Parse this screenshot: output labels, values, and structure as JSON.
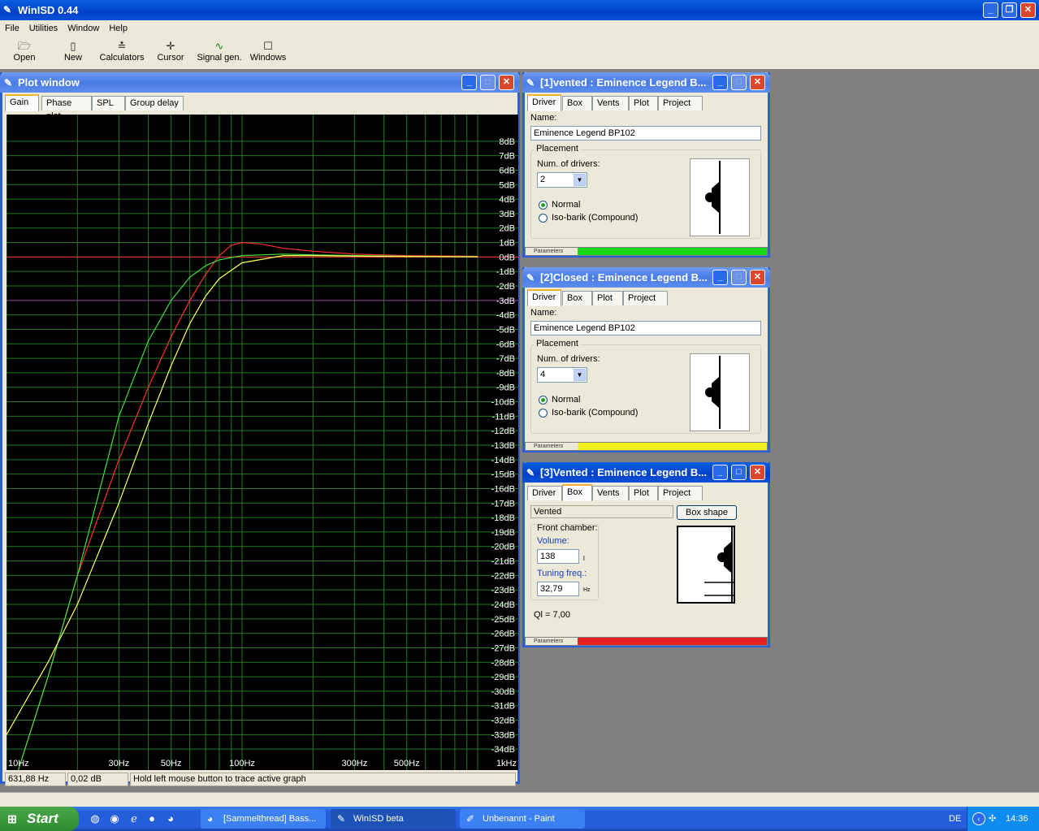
{
  "app": {
    "title": "WinISD 0.44"
  },
  "menu": [
    "File",
    "Utilities",
    "Window",
    "Help"
  ],
  "toolbar": [
    {
      "label": "Open",
      "icon": "folder-open-icon"
    },
    {
      "label": "New",
      "icon": "new-document-icon"
    },
    {
      "label": "Calculators",
      "icon": "calculator-icon"
    },
    {
      "label": "Cursor",
      "icon": "cursor-icon"
    },
    {
      "label": "Signal gen.",
      "icon": "signal-generator-icon"
    },
    {
      "label": "Windows",
      "icon": "windows-icon"
    }
  ],
  "plot_window": {
    "title": "Plot window",
    "tabs": [
      "Gain",
      "Phase plot",
      "SPL",
      "Group delay"
    ],
    "status": {
      "freq": "631,88 Hz",
      "gain": "0,02 dB",
      "hint": "Hold left mouse button to trace active graph"
    }
  },
  "chart_data": {
    "type": "line",
    "x_tick_labels": [
      "10Hz",
      "30Hz",
      "50Hz",
      "100Hz",
      "300Hz",
      "500Hz",
      "1kHz"
    ],
    "x_ticks": [
      10,
      30,
      50,
      100,
      300,
      500,
      1000
    ],
    "y_tick_labels": [
      "8dB",
      "7dB",
      "6dB",
      "5dB",
      "4dB",
      "3dB",
      "2dB",
      "1dB",
      "0dB",
      "-1dB",
      "-2dB",
      "-3dB",
      "-4dB",
      "-5dB",
      "-6dB",
      "-7dB",
      "-8dB",
      "-9dB",
      "-10dB",
      "-11dB",
      "-12dB",
      "-13dB",
      "-14dB",
      "-15dB",
      "-16dB",
      "-17dB",
      "-18dB",
      "-19dB",
      "-20dB",
      "-21dB",
      "-22dB",
      "-23dB",
      "-24dB",
      "-25dB",
      "-26dB",
      "-27dB",
      "-28dB",
      "-29dB",
      "-30dB",
      "-31dB",
      "-32dB",
      "-33dB",
      "-34dB"
    ],
    "xlim": [
      10,
      1000
    ],
    "ylim": [
      -35,
      9
    ],
    "x_scale": "log",
    "grid": true,
    "series": [
      {
        "color": "#ff3030",
        "x": [
          10,
          15,
          20,
          30,
          40,
          50,
          60,
          70,
          80,
          90,
          100,
          120,
          150,
          200,
          300,
          500,
          1000
        ],
        "y": [
          -38,
          -29,
          -22,
          -14,
          -9,
          -5.5,
          -3,
          -1.2,
          0.1,
          0.8,
          1.0,
          0.9,
          0.6,
          0.4,
          0.2,
          0.1,
          0.05
        ]
      },
      {
        "color": "#40e040",
        "x": [
          10,
          15,
          20,
          30,
          40,
          50,
          60,
          70,
          80,
          100,
          150,
          200,
          300,
          500,
          1000
        ],
        "y": [
          -38,
          -29,
          -22,
          -11,
          -5.8,
          -3,
          -1.4,
          -0.6,
          -0.2,
          0.1,
          0.2,
          0.15,
          0.1,
          0.05,
          0.02
        ]
      },
      {
        "color": "#ffff60",
        "x": [
          10,
          15,
          20,
          30,
          40,
          50,
          60,
          70,
          80,
          100,
          150,
          200,
          300,
          500,
          1000
        ],
        "y": [
          -33,
          -28,
          -24,
          -17,
          -11.5,
          -7.5,
          -4.6,
          -2.7,
          -1.5,
          -0.4,
          0.1,
          0.1,
          0.06,
          0.03,
          0.01
        ]
      }
    ],
    "reference_lines": [
      {
        "y": 0,
        "color": "#ff3030"
      },
      {
        "y": -3,
        "color": "#9b2fa0"
      }
    ]
  },
  "win1": {
    "title": "[1]vented : Eminence Legend B...",
    "tabs": [
      "Driver",
      "Box",
      "Vents",
      "Plot",
      "Project"
    ],
    "name_label": "Name:",
    "name_value": "Eminence Legend BP102",
    "placement_label": "Placement",
    "num_label": "Num. of drivers:",
    "num_value": "2",
    "radio_normal": "Normal",
    "radio_iso": "Iso-barik (Compound)",
    "bar_label": "Parameters",
    "bar_color": "#19d819"
  },
  "win2": {
    "title": "[2]Closed : Eminence Legend B...",
    "tabs": [
      "Driver",
      "Box",
      "Plot",
      "Project"
    ],
    "name_label": "Name:",
    "name_value": "Eminence Legend BP102",
    "placement_label": "Placement",
    "num_label": "Num. of drivers:",
    "num_value": "4",
    "radio_normal": "Normal",
    "radio_iso": "Iso-barik (Compound)",
    "bar_label": "Parameters",
    "bar_color": "#f0f020"
  },
  "win3": {
    "title": "[3]Vented : Eminence Legend B...",
    "tabs": [
      "Driver",
      "Box",
      "Vents",
      "Plot",
      "Project"
    ],
    "box_type": "Vented",
    "box_shape_button": "Box shape",
    "front_chamber": "Front chamber:",
    "volume_label": "Volume:",
    "volume_value": "138",
    "volume_unit": "l",
    "tuning_label": "Tuning freq.:",
    "tuning_value": "32,79",
    "tuning_unit": "Hz",
    "ql_text": "Ql = 7,00",
    "bar_label": "Parameters",
    "bar_color": "#e62020"
  },
  "taskbar": {
    "start": "Start",
    "tasks": [
      "[Sammelthread] Bass...",
      "WinISD beta",
      "Unbenannt - Paint"
    ],
    "lang": "DE",
    "clock": "14:36"
  }
}
